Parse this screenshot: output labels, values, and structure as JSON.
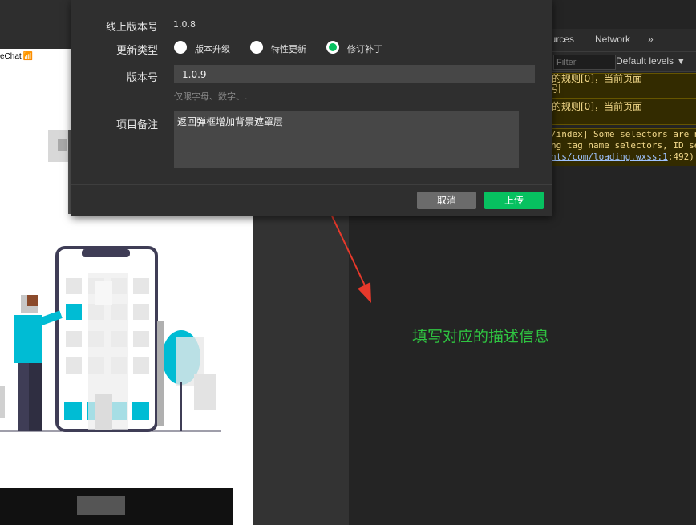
{
  "simulator": {
    "status_label": "eChat",
    "wifi_icon": "wifi-icon"
  },
  "devtools": {
    "tabs": [
      "ources",
      "Network",
      "»"
    ],
    "filter_placeholder": "Filter",
    "levels_label": "Default levels ▼",
    "warnings": [
      {
        "line1": "的规则[0]，当前页面",
        "line2": "引"
      },
      {
        "line1": "的规则[0]，当前页面",
        "line2": ""
      }
    ],
    "warning_multi": {
      "line1": "/index] Some selectors are n",
      "line2": "ng tag name selectors, ID se",
      "link": "nts/com/loading.wxss:1",
      "line3_suffix": ":492)"
    }
  },
  "annotation": {
    "hint": "填写对应的描述信息",
    "color": "#2fc441",
    "arrow_color": "#e8392b"
  },
  "dialog": {
    "online_version_label": "线上版本号",
    "online_version_value": "1.0.8",
    "update_type_label": "更新类型",
    "update_options": [
      {
        "label": "版本升级",
        "selected": false
      },
      {
        "label": "特性更新",
        "selected": false
      },
      {
        "label": "修订补丁",
        "selected": true
      }
    ],
    "version_label": "版本号",
    "version_value": "1.0.9",
    "version_hint": "仅限字母、数字、.",
    "remark_label": "项目备注",
    "remark_value": "返回弹框增加背景遮罩层",
    "cancel_label": "取消",
    "upload_label": "上传",
    "accent_color": "#07c160"
  }
}
